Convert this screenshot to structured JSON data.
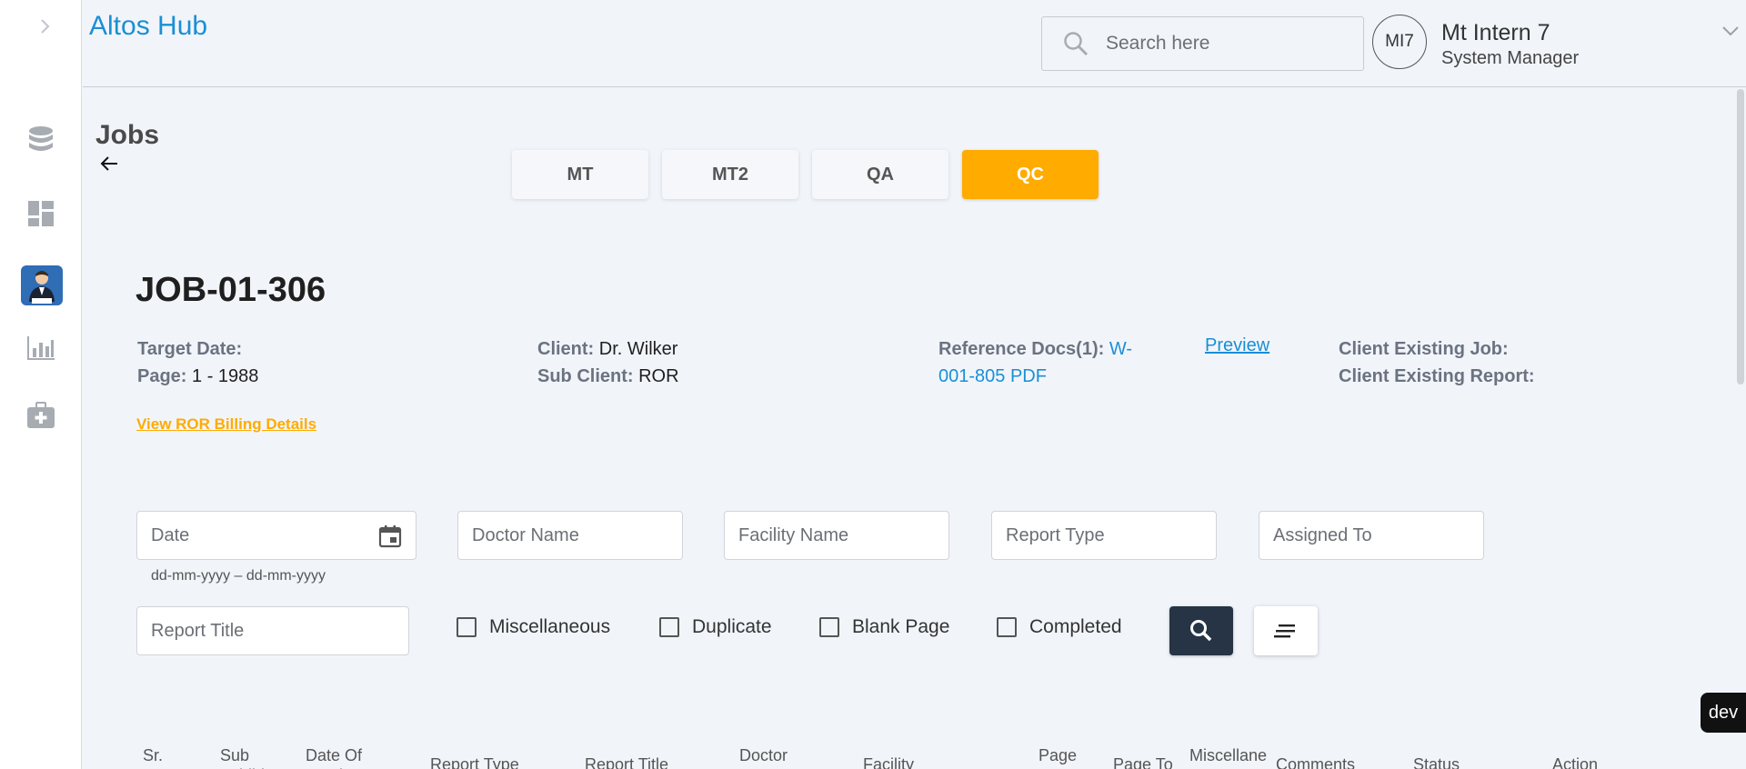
{
  "app": {
    "brand": "Altos Hub"
  },
  "sidebar": {
    "items": [
      {
        "icon": "database-icon"
      },
      {
        "icon": "dashboard-icon"
      },
      {
        "icon": "doctor-avatar-icon"
      },
      {
        "icon": "bar-chart-icon"
      },
      {
        "icon": "medical-kit-icon"
      }
    ]
  },
  "header": {
    "search_placeholder": "Search here",
    "user": {
      "initials": "MI7",
      "name": "Mt Intern 7",
      "role": "System Manager"
    }
  },
  "page": {
    "title": "Jobs"
  },
  "tabs": [
    {
      "label": "MT",
      "active": false
    },
    {
      "label": "MT2",
      "active": false
    },
    {
      "label": "QA",
      "active": false
    },
    {
      "label": "QC",
      "active": true
    }
  ],
  "job": {
    "id": "JOB-01-306",
    "target_date_label": "Target Date:",
    "target_date_value": "",
    "page_label": "Page:",
    "page_value": " 1 - 1988",
    "client_label": "Client:",
    "client_value": " Dr. Wilker",
    "sub_client_label": "Sub Client:",
    "sub_client_value": " ROR",
    "ref_docs_label": "Reference Docs(1):",
    "ref_docs_value_line1": " W-",
    "ref_docs_value_line2": "001-805 PDF",
    "preview_label": "Preview",
    "client_existing_job_label": "Client Existing Job:",
    "client_existing_report_label": "Client Existing Report:",
    "billing_link": "View ROR Billing Details"
  },
  "filters": {
    "date_placeholder": "Date",
    "date_hint": "dd-mm-yyyy – dd-mm-yyyy",
    "doctor_placeholder": "Doctor Name",
    "facility_placeholder": "Facility Name",
    "report_type_placeholder": "Report Type",
    "assigned_to_placeholder": "Assigned To",
    "report_title_placeholder": "Report Title",
    "checkboxes": {
      "miscellaneous": "Miscellaneous",
      "duplicate": "Duplicate",
      "blank_page": "Blank Page",
      "completed": "Completed"
    }
  },
  "badge": {
    "env": "dev"
  },
  "table": {
    "headers": {
      "sr_no": "Sr.\nNo.",
      "sub_exhibit": "Sub\nExhibit",
      "date_of_service": "Date Of\nService",
      "report_type": "Report Type",
      "report_title": "Report Title",
      "doctor_name": "Doctor\nName",
      "facility": "Facility",
      "page_from": "Page\nFrom",
      "page_to": "Page To",
      "miscellaneous": "Miscellane",
      "comments": "Comments",
      "status": "Status",
      "action": "Action"
    }
  }
}
